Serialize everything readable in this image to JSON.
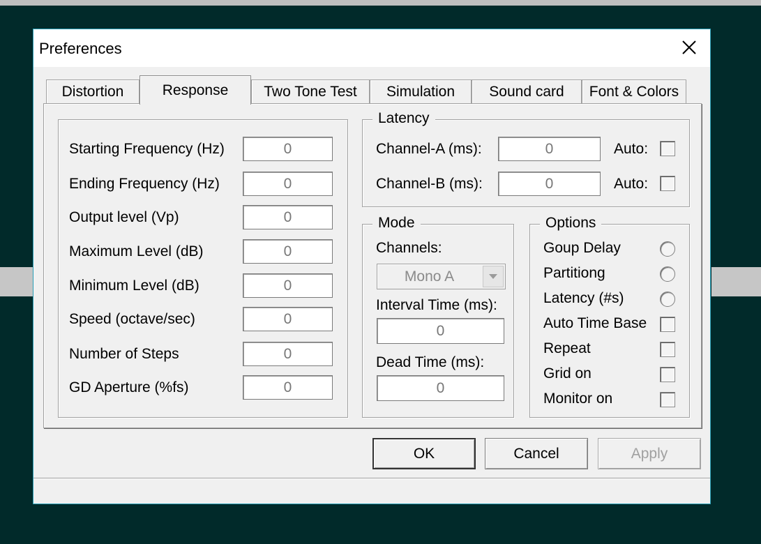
{
  "window": {
    "title": "Preferences"
  },
  "tabs": [
    {
      "label": "Distortion"
    },
    {
      "label": "Response",
      "active": true
    },
    {
      "label": "Two Tone Test"
    },
    {
      "label": "Simulation"
    },
    {
      "label": "Sound card"
    },
    {
      "label": "Font & Colors"
    }
  ],
  "response": {
    "fields": [
      {
        "label": "Starting Frequency (Hz)",
        "value": "0"
      },
      {
        "label": "Ending Frequency (Hz)",
        "value": "0"
      },
      {
        "label": "Output level (Vp)",
        "value": "0"
      },
      {
        "label": "Maximum Level (dB)",
        "value": "0"
      },
      {
        "label": "Minimum Level (dB)",
        "value": "0"
      },
      {
        "label": "Speed (octave/sec)",
        "value": "0"
      },
      {
        "label": "Number of Steps",
        "value": "0"
      },
      {
        "label": "GD Aperture (%fs)",
        "value": "0"
      }
    ]
  },
  "latency": {
    "title": "Latency",
    "channel_a": {
      "label": "Channel-A (ms):",
      "value": "0",
      "auto_label": "Auto:",
      "auto_checked": false
    },
    "channel_b": {
      "label": "Channel-B (ms):",
      "value": "0",
      "auto_label": "Auto:",
      "auto_checked": false
    }
  },
  "mode": {
    "title": "Mode",
    "channels_label": "Channels:",
    "channels_value": "Mono A",
    "interval_label": "Interval Time (ms):",
    "interval_value": "0",
    "dead_label": "Dead Time (ms):",
    "dead_value": "0"
  },
  "options": {
    "title": "Options",
    "items": [
      {
        "label": "Goup Delay",
        "control": "radio",
        "checked": false
      },
      {
        "label": "Partitiong",
        "control": "radio",
        "checked": false
      },
      {
        "label": "Latency (#s)",
        "control": "radio",
        "checked": false
      },
      {
        "label": "Auto Time Base",
        "control": "checkbox",
        "checked": false
      },
      {
        "label": "Repeat",
        "control": "checkbox",
        "checked": false
      },
      {
        "label": "Grid on",
        "control": "checkbox",
        "checked": false
      },
      {
        "label": "Monitor on",
        "control": "checkbox",
        "checked": false
      }
    ]
  },
  "buttons": {
    "ok": "OK",
    "cancel": "Cancel",
    "apply": "Apply"
  },
  "icons": {
    "close": "close-icon",
    "dropdown": "chevron-down-icon"
  },
  "colors": {
    "desktop": "#012a2a",
    "dialog_border": "#2aa0b8",
    "dialog_bg": "#f0f0f0"
  }
}
